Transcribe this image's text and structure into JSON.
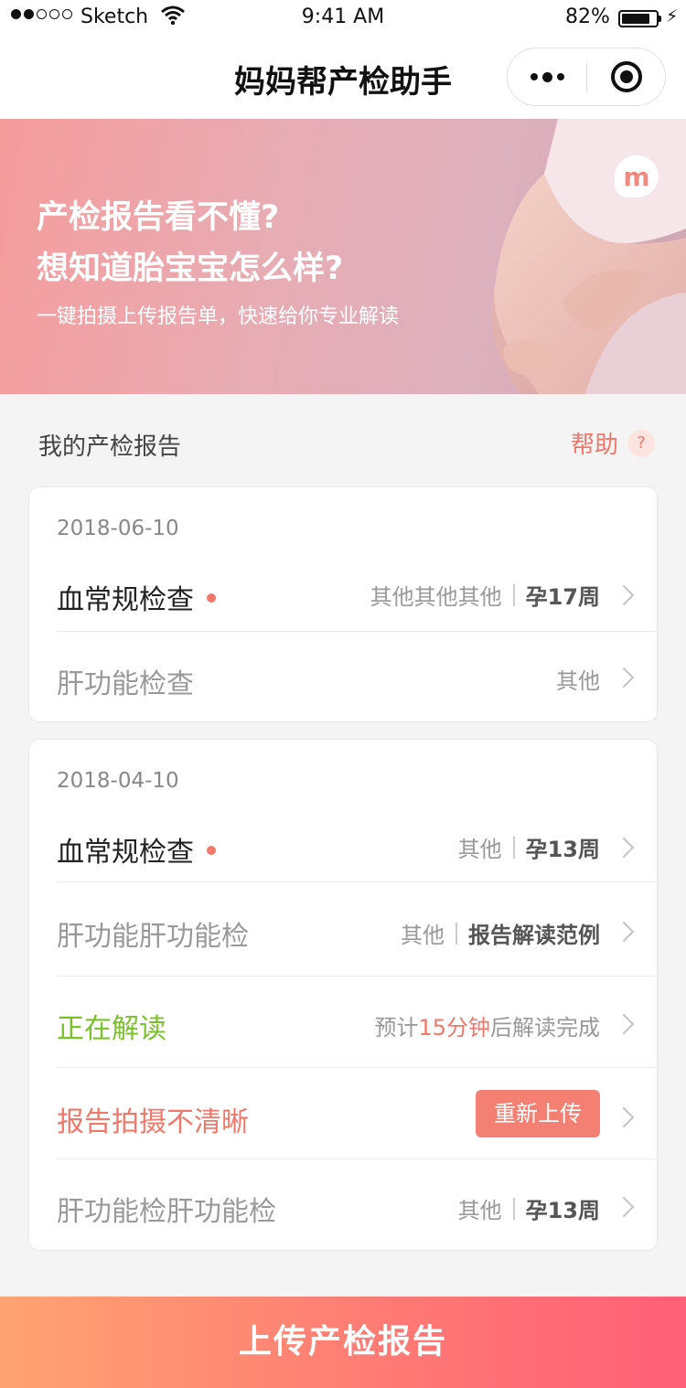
{
  "status_bar": {
    "carrier": "Sketch",
    "time": "9:41 AM",
    "battery": "82%",
    "battery_level": 0.82
  },
  "nav": {
    "title": "妈妈帮产检助手"
  },
  "banner": {
    "headline_1": "产检报告看不懂?",
    "headline_2": "想知道胎宝宝怎么样?",
    "subtitle": "一键拍摄上传报告单，快速给你专业解读",
    "logo_text": "m"
  },
  "section": {
    "title": "我的产检报告",
    "help_label": "帮助",
    "help_icon": "?"
  },
  "cards": [
    {
      "date": "2018-06-10",
      "rows": [
        {
          "name": "血常规检查",
          "tag": "其他其他其他",
          "week": "孕17周"
        },
        {
          "name": "肝功能检查",
          "tag": "其他"
        }
      ]
    },
    {
      "date": "2018-04-10",
      "rows": [
        {
          "name": "血常规检查",
          "tag": "其他",
          "week": "孕13周"
        },
        {
          "name": "肝功能肝功能检",
          "tag": "其他",
          "example": "报告解读范例"
        },
        {
          "name": "正在解读",
          "eta_prefix": "预计",
          "eta_value": "15分钟",
          "eta_suffix": "后解读完成"
        },
        {
          "name": "报告拍摄不清晰",
          "button": "重新上传"
        },
        {
          "name": "肝功能检肝功能检",
          "tag": "其他",
          "week": "孕13周"
        }
      ]
    }
  ],
  "bottom_button": "上传产检报告",
  "colors": {
    "accent": "#f0786a",
    "reading_green": "#7ac12a",
    "gradient_start": "#ffa372",
    "gradient_end": "#ff5f78"
  }
}
